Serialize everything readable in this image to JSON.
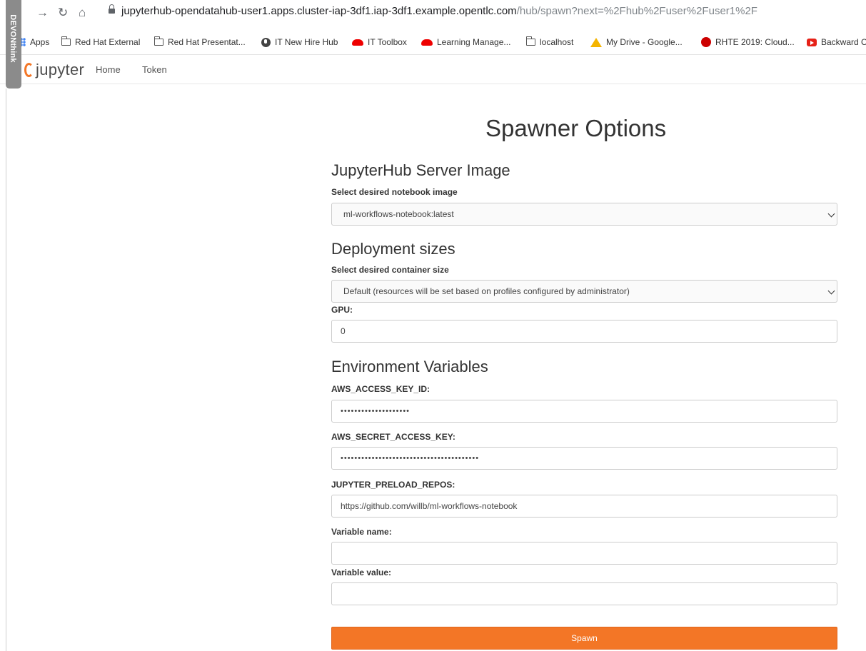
{
  "browser": {
    "url_host": "jupyterhub-opendatahub-user1.apps.cluster-iap-3df1.iap-3df1.example.opentlc.com",
    "url_path": "/hub/spawn?next=%2Fhub%2Fuser%2Fuser1%2F",
    "back_glyph": "←",
    "forward_glyph": "→",
    "reload_glyph": "↻",
    "home_glyph": "⌂",
    "bookmarks": [
      {
        "label": "Apps",
        "icon": "apps-icon"
      },
      {
        "label": "Red Hat External",
        "icon": "folder-icon"
      },
      {
        "label": "Red Hat Presentat...",
        "icon": "folder-icon"
      },
      {
        "label": "IT New Hire Hub",
        "icon": "globe-icon"
      },
      {
        "label": "IT Toolbox",
        "icon": "redhat-icon"
      },
      {
        "label": "Learning Manage...",
        "icon": "redhat-icon"
      },
      {
        "label": "localhost",
        "icon": "folder-icon"
      },
      {
        "label": "My Drive - Google...",
        "icon": "google-drive-icon"
      },
      {
        "label": "RHTE 2019: Cloud...",
        "icon": "rhte-icon"
      },
      {
        "label": "Backward C",
        "icon": "youtube-icon"
      }
    ],
    "devonthink_label": "DEVONthink"
  },
  "header": {
    "logo_text": "jupyter",
    "nav": [
      "Home",
      "Token"
    ]
  },
  "form": {
    "title": "Spawner Options",
    "image_section": {
      "heading": "JupyterHub Server Image",
      "label": "Select desired notebook image",
      "selected": "ml-workflows-notebook:latest"
    },
    "size_section": {
      "heading": "Deployment sizes",
      "label": "Select desired container size",
      "selected": "Default (resources will be set based on profiles configured by administrator)",
      "gpu_label": "GPU:",
      "gpu_value": "0"
    },
    "env_section": {
      "heading": "Environment Variables",
      "aws_access_label": "AWS_ACCESS_KEY_ID:",
      "aws_access_value": "••••••••••••••••••••",
      "aws_secret_label": "AWS_SECRET_ACCESS_KEY:",
      "aws_secret_value": "••••••••••••••••••••••••••••••••••••••••",
      "preload_label": "JUPYTER_PRELOAD_REPOS:",
      "preload_value": "https://github.com/willb/ml-workflows-notebook",
      "var_name_label": "Variable name:",
      "var_name_value": "",
      "var_value_label": "Variable value:",
      "var_value_value": ""
    },
    "spawn_label": "Spawn"
  },
  "colors": {
    "accent": "#f37626",
    "devonthink_tab": "#8b8b8b"
  }
}
